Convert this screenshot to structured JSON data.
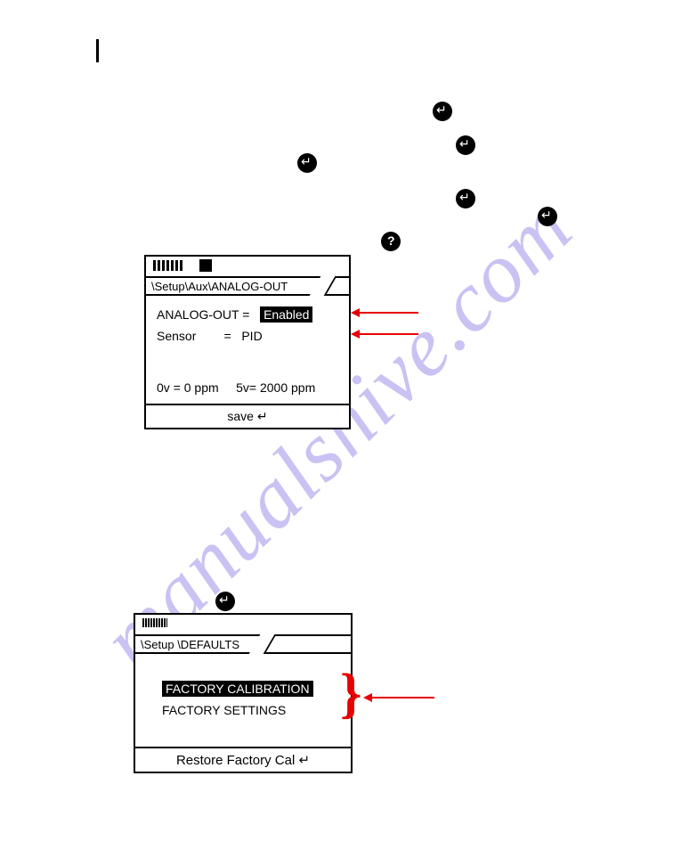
{
  "watermark": "manualshive.com",
  "screen1": {
    "breadcrumb": "\\Setup\\Aux\\ANALOG-OUT",
    "row1_label": "ANALOG-OUT",
    "row1_eq": "=",
    "row1_value": "Enabled",
    "row2_label": "Sensor",
    "row2_eq": "=",
    "row2_value": "PID",
    "footleft": "0v = 0 ppm",
    "footright": "5v= 2000 ppm",
    "save": "save  ↵"
  },
  "screen2": {
    "breadcrumb": "\\Setup \\DEFAULTS",
    "item1": "FACTORY CALIBRATION",
    "item2": "FACTORY SETTINGS",
    "restore": "Restore Factory Cal  ↵"
  }
}
